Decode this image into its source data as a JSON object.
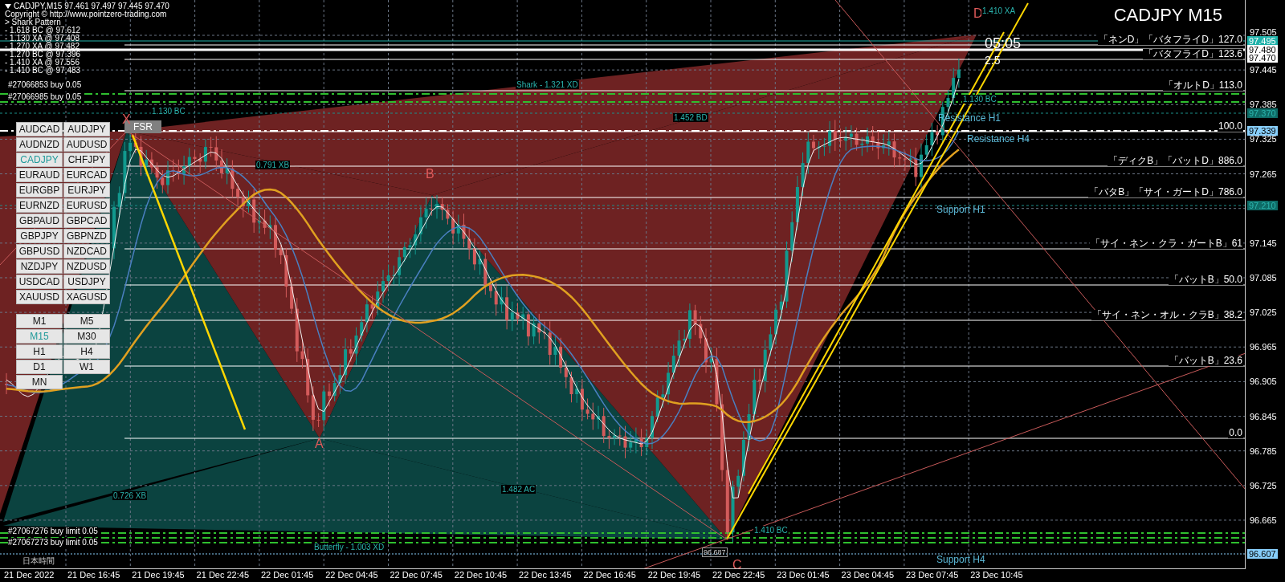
{
  "chart_info": {
    "title_line": "CADJPY,M15  97.461 97.497 97.445 97.470",
    "copyright": "Copyright © http://www.pointzero-trading.com",
    "indicator": "> Shark Pattern",
    "levels": [
      "- 1.618 BC @ 97.612",
      "- 1.130 XA @ 97.408",
      "- 1.270 XA @ 97.482",
      "- 1.270 BC @ 97.396",
      "- 1.410 XA @ 97.556",
      "- 1.410 BC @ 97.483"
    ]
  },
  "orders": [
    "#27066853 buy 0.05",
    "#27066985 buy 0.05",
    "#27067276 buy limit 0.05",
    "#27067273 buy limit 0.05"
  ],
  "symbol_title": "CADJPY M15",
  "symbol_buttons": [
    {
      "label": "AUDCAD",
      "selected": false
    },
    {
      "label": "AUDJPY",
      "selected": false
    },
    {
      "label": "AUDNZD",
      "selected": false
    },
    {
      "label": "AUDUSD",
      "selected": false
    },
    {
      "label": "CADJPY",
      "selected": true
    },
    {
      "label": "CHFJPY",
      "selected": false
    },
    {
      "label": "EURAUD",
      "selected": false
    },
    {
      "label": "EURCAD",
      "selected": false
    },
    {
      "label": "EURGBP",
      "selected": false
    },
    {
      "label": "EURJPY",
      "selected": false
    },
    {
      "label": "EURNZD",
      "selected": false
    },
    {
      "label": "EURUSD",
      "selected": false
    },
    {
      "label": "GBPAUD",
      "selected": false
    },
    {
      "label": "GBPCAD",
      "selected": false
    },
    {
      "label": "GBPJPY",
      "selected": false
    },
    {
      "label": "GBPNZD",
      "selected": false
    },
    {
      "label": "GBPUSD",
      "selected": false
    },
    {
      "label": "NZDCAD",
      "selected": false
    },
    {
      "label": "NZDJPY",
      "selected": false
    },
    {
      "label": "NZDUSD",
      "selected": false
    },
    {
      "label": "USDCAD",
      "selected": false
    },
    {
      "label": "USDJPY",
      "selected": false
    },
    {
      "label": "XAUUSD",
      "selected": false
    },
    {
      "label": "XAGUSD",
      "selected": false
    }
  ],
  "timeframe_buttons": [
    {
      "label": "M1",
      "selected": false
    },
    {
      "label": "M5",
      "selected": false
    },
    {
      "label": "M15",
      "selected": true
    },
    {
      "label": "M30",
      "selected": false
    },
    {
      "label": "H1",
      "selected": false
    },
    {
      "label": "H4",
      "selected": false
    },
    {
      "label": "D1",
      "selected": false
    },
    {
      "label": "W1",
      "selected": false
    },
    {
      "label": "MN",
      "selected": false
    }
  ],
  "fsr_button": "FSR",
  "countdown": {
    "time": "05:05",
    "spread": "2.5"
  },
  "pattern_points": [
    "X",
    "A",
    "B",
    "C",
    "D"
  ],
  "pattern_labels": [
    "1.410 XA",
    "Shark - 1.321 XD",
    "1.130 BC",
    "1.452 BD",
    "0.791 XB",
    "0.726 XB",
    "1.482 AC",
    "Butterfly - 1.003 XD",
    "1.410 BC",
    "1.130 BC"
  ],
  "sr_labels": [
    "Resistance H1",
    "Resistance H4",
    "Support H1",
    "Support H4"
  ],
  "fib_levels": [
    "「ネンD」「バタフライD」127.0",
    "「バタフライD」123.6",
    "「オルトD」113.0",
    "100.0",
    "「ディクB」「バットD」886.0",
    "「バタB」「サイ・ガートD」786.0",
    "「サイ・ネン・クラ・ガートB」61",
    "「バットB」50.0",
    "「サイ・ネン・オル・クラB」38.2",
    "「バットB」23.6",
    "0.0"
  ],
  "low_price_tag": "96.687",
  "price_axis": {
    "ticks": [
      "97.505",
      "97.445",
      "97.385",
      "97.325",
      "97.265",
      "97.145",
      "97.085",
      "97.025",
      "96.965",
      "96.905",
      "96.845",
      "96.785",
      "96.725",
      "96.665"
    ],
    "markers": [
      {
        "value": "97.495",
        "color": "#20b2aa"
      },
      {
        "value": "97.480",
        "color": "#ffffff"
      },
      {
        "value": "97.470",
        "color": "#ffffff"
      },
      {
        "value": "97.370",
        "color": "#0e6b66"
      },
      {
        "value": "97.339",
        "color": "#87cefa"
      },
      {
        "value": "97.210",
        "color": "#0e6b66"
      },
      {
        "value": "96.607",
        "color": "#87cefa"
      }
    ]
  },
  "time_axis": [
    "21 Dec 2022",
    "21 Dec 16:45",
    "21 Dec 19:45",
    "21 Dec 22:45",
    "22 Dec 01:45",
    "22 Dec 04:45",
    "22 Dec 07:45",
    "22 Dec 10:45",
    "22 Dec 13:45",
    "22 Dec 16:45",
    "22 Dec 19:45",
    "22 Dec 22:45",
    "23 Dec 01:45",
    "23 Dec 04:45",
    "23 Dec 07:45",
    "23 Dec 10:45"
  ],
  "timezone_label": "日本時間"
}
